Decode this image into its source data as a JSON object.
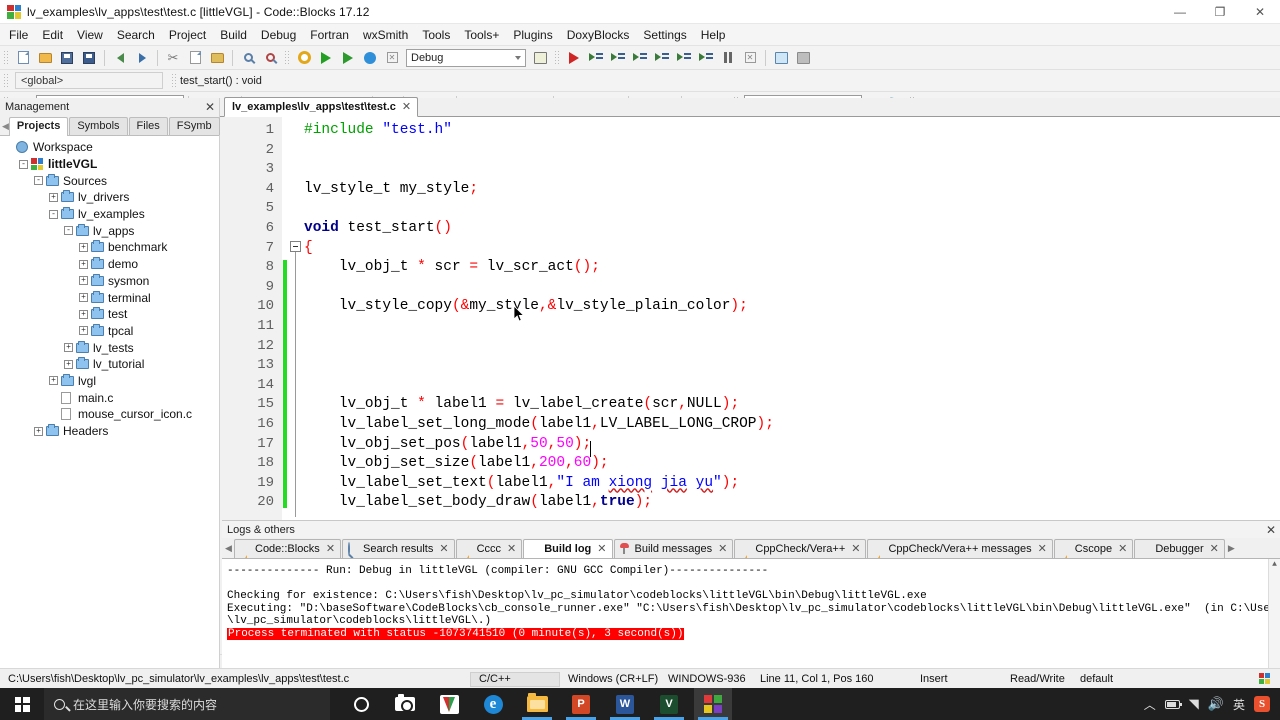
{
  "window": {
    "title": "lv_examples\\lv_apps\\test\\test.c [littleVGL] - Code::Blocks 17.12",
    "minimize": "—",
    "maximize": "❐",
    "close": "✕"
  },
  "menubar": {
    "items": [
      "File",
      "Edit",
      "View",
      "Search",
      "Project",
      "Build",
      "Debug",
      "Fortran",
      "wxSmith",
      "Tools",
      "Tools+",
      "Plugins",
      "DoxyBlocks",
      "Settings",
      "Help"
    ]
  },
  "toolbar": {
    "build_target": "Debug",
    "scope_selector": "<global>",
    "current_function": "test_start() : void",
    "find_value": "",
    "doxy_value": ""
  },
  "management": {
    "title": "Management",
    "close_label": "✕",
    "prev_tab": "◀",
    "next_tab": "▶",
    "tabs": [
      {
        "label": "Projects",
        "active": true
      },
      {
        "label": "Symbols",
        "active": false
      },
      {
        "label": "Files",
        "active": false
      },
      {
        "label": "FSymb",
        "active": false
      }
    ],
    "tree": [
      {
        "label": "Workspace",
        "depth": 0,
        "icon": "workspace-icon",
        "expander": "",
        "bold": false
      },
      {
        "label": "littleVGL",
        "depth": 1,
        "icon": "project-icon",
        "expander": "-",
        "bold": true
      },
      {
        "label": "Sources",
        "depth": 2,
        "icon": "folder-icon",
        "expander": "-",
        "bold": false
      },
      {
        "label": "lv_drivers",
        "depth": 3,
        "icon": "folder-icon",
        "expander": "+",
        "bold": false
      },
      {
        "label": "lv_examples",
        "depth": 3,
        "icon": "folder-icon",
        "expander": "-",
        "bold": false
      },
      {
        "label": "lv_apps",
        "depth": 4,
        "icon": "folder-icon",
        "expander": "-",
        "bold": false
      },
      {
        "label": "benchmark",
        "depth": 5,
        "icon": "folder-icon",
        "expander": "+",
        "bold": false
      },
      {
        "label": "demo",
        "depth": 5,
        "icon": "folder-icon",
        "expander": "+",
        "bold": false
      },
      {
        "label": "sysmon",
        "depth": 5,
        "icon": "folder-icon",
        "expander": "+",
        "bold": false
      },
      {
        "label": "terminal",
        "depth": 5,
        "icon": "folder-icon",
        "expander": "+",
        "bold": false
      },
      {
        "label": "test",
        "depth": 5,
        "icon": "folder-icon",
        "expander": "+",
        "bold": false
      },
      {
        "label": "tpcal",
        "depth": 5,
        "icon": "folder-icon",
        "expander": "+",
        "bold": false
      },
      {
        "label": "lv_tests",
        "depth": 4,
        "icon": "folder-icon",
        "expander": "+",
        "bold": false
      },
      {
        "label": "lv_tutorial",
        "depth": 4,
        "icon": "folder-icon",
        "expander": "+",
        "bold": false
      },
      {
        "label": "lvgl",
        "depth": 3,
        "icon": "folder-icon",
        "expander": "+",
        "bold": false
      },
      {
        "label": "main.c",
        "depth": 3,
        "icon": "file-icon",
        "expander": "",
        "bold": false
      },
      {
        "label": "mouse_cursor_icon.c",
        "depth": 3,
        "icon": "file-icon",
        "expander": "",
        "bold": false
      },
      {
        "label": "Headers",
        "depth": 2,
        "icon": "folder-icon",
        "expander": "+",
        "bold": false
      }
    ]
  },
  "editor": {
    "tab_label": "lv_examples\\lv_apps\\test\\test.c",
    "tab_close": "✕",
    "first_line": 1,
    "lines": [
      {
        "n": 1,
        "text": "#include \"test.h\""
      },
      {
        "n": 2,
        "text": ""
      },
      {
        "n": 3,
        "text": ""
      },
      {
        "n": 4,
        "text": "lv_style_t my_style;"
      },
      {
        "n": 5,
        "text": ""
      },
      {
        "n": 6,
        "text": "void test_start()"
      },
      {
        "n": 7,
        "text": "{"
      },
      {
        "n": 8,
        "text": "    lv_obj_t * scr = lv_scr_act();"
      },
      {
        "n": 9,
        "text": ""
      },
      {
        "n": 10,
        "text": "    lv_style_copy(&my_style,&lv_style_plain_color);"
      },
      {
        "n": 11,
        "text": ""
      },
      {
        "n": 12,
        "text": ""
      },
      {
        "n": 13,
        "text": ""
      },
      {
        "n": 14,
        "text": ""
      },
      {
        "n": 15,
        "text": "    lv_obj_t * label1 = lv_label_create(scr,NULL);"
      },
      {
        "n": 16,
        "text": "    lv_label_set_long_mode(label1,LV_LABEL_LONG_CROP);"
      },
      {
        "n": 17,
        "text": "    lv_obj_set_pos(label1,50,50);"
      },
      {
        "n": 18,
        "text": "    lv_obj_set_size(label1,200,60);"
      },
      {
        "n": 19,
        "text": "    lv_label_set_text(label1,\"I am xiong jia yu\");"
      },
      {
        "n": 20,
        "text": "    lv_label_set_body_draw(label1,true);"
      }
    ],
    "scroll_left": "◀",
    "scroll_right": "▶"
  },
  "logs": {
    "title": "Logs & others",
    "close_label": "✕",
    "prev_tab": "◀",
    "next_tab": "▶",
    "tabs": [
      {
        "label": "Code::Blocks",
        "icon": "pencil-icon",
        "active": false,
        "close": "✕"
      },
      {
        "label": "Search results",
        "icon": "search-icon",
        "active": false,
        "close": "✕"
      },
      {
        "label": "Cccc",
        "icon": "pencil-icon",
        "active": false,
        "close": "✕"
      },
      {
        "label": "Build log",
        "icon": "bulb-icon",
        "active": true,
        "close": "✕"
      },
      {
        "label": "Build messages",
        "icon": "pin-icon",
        "active": false,
        "close": "✕"
      },
      {
        "label": "CppCheck/Vera++",
        "icon": "pencil-icon",
        "active": false,
        "close": "✕"
      },
      {
        "label": "CppCheck/Vera++ messages",
        "icon": "pencil-icon",
        "active": false,
        "close": "✕"
      },
      {
        "label": "Cscope",
        "icon": "pencil-icon",
        "active": false,
        "close": "✕"
      },
      {
        "label": "Debugger",
        "icon": "bulb-icon",
        "active": false,
        "close": "✕"
      }
    ],
    "build_output": [
      {
        "text": "-------------- Run: Debug in littleVGL (compiler: GNU GCC Compiler)---------------",
        "error": false
      },
      {
        "text": "",
        "error": false
      },
      {
        "text": "Checking for existence: C:\\Users\\fish\\Desktop\\lv_pc_simulator\\codeblocks\\littleVGL\\bin\\Debug\\littleVGL.exe",
        "error": false
      },
      {
        "text": "Executing: \"D:\\baseSoftware\\CodeBlocks\\cb_console_runner.exe\" \"C:\\Users\\fish\\Desktop\\lv_pc_simulator\\codeblocks\\littleVGL\\bin\\Debug\\littleVGL.exe\"  (in C:\\Users\\fish\\Desktop",
        "error": false
      },
      {
        "text": "\\lv_pc_simulator\\codeblocks\\littleVGL\\.)",
        "error": false
      },
      {
        "text": "Process terminated with status -1073741510 (0 minute(s), 3 second(s))",
        "error": true
      }
    ],
    "scroll_up": "▲"
  },
  "statusbar": {
    "file_path": "C:\\Users\\fish\\Desktop\\lv_pc_simulator\\lv_examples\\lv_apps\\test\\test.c",
    "language": "C/C++",
    "line_ending": "Windows (CR+LF)",
    "encoding": "WINDOWS-936",
    "caret": "Line 11, Col 1, Pos 160",
    "insert_mode": "Insert",
    "rw_mode": "Read/Write",
    "profile": "default"
  },
  "taskbar": {
    "search_placeholder": "在这里输入你要搜索的内容",
    "apps": [
      {
        "name": "cortana-icon",
        "running": false,
        "active": false
      },
      {
        "name": "camera-icon",
        "running": false,
        "active": false
      },
      {
        "name": "pdf-reader-icon",
        "running": false,
        "active": false
      },
      {
        "name": "edge-browser-icon",
        "running": false,
        "active": false
      },
      {
        "name": "file-explorer-icon",
        "running": true,
        "active": false
      },
      {
        "name": "powerpoint-icon",
        "running": true,
        "active": false
      },
      {
        "name": "word-icon",
        "running": true,
        "active": false
      },
      {
        "name": "visual-studio-icon",
        "running": true,
        "active": false
      },
      {
        "name": "codeblocks-icon",
        "running": true,
        "active": true
      }
    ],
    "tray": {
      "chevron": "︿",
      "battery": "battery-icon",
      "wifi": "wifi-icon",
      "volume": "volume-icon",
      "ime": "英",
      "sogou": "S"
    }
  }
}
